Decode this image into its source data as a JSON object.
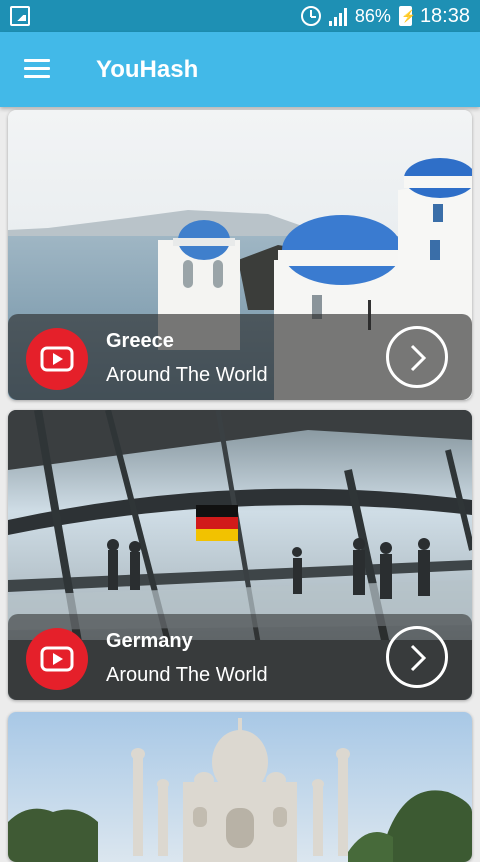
{
  "status_bar": {
    "battery_percent": "86%",
    "time": "18:38",
    "icons": [
      "gallery-icon",
      "alarm-icon",
      "signal-icon",
      "battery-charging-icon"
    ]
  },
  "app_bar": {
    "title": "YouHash",
    "menu_icon": "hamburger-menu-icon"
  },
  "cards": [
    {
      "title": "Greece",
      "subtitle": "Around The World"
    },
    {
      "title": "Germany",
      "subtitle": "Around The World"
    },
    {
      "title": "",
      "subtitle": ""
    }
  ],
  "colors": {
    "status_bar": "#1e90b4",
    "app_bar": "#42b9e8",
    "youtube_red": "#e5202a"
  }
}
